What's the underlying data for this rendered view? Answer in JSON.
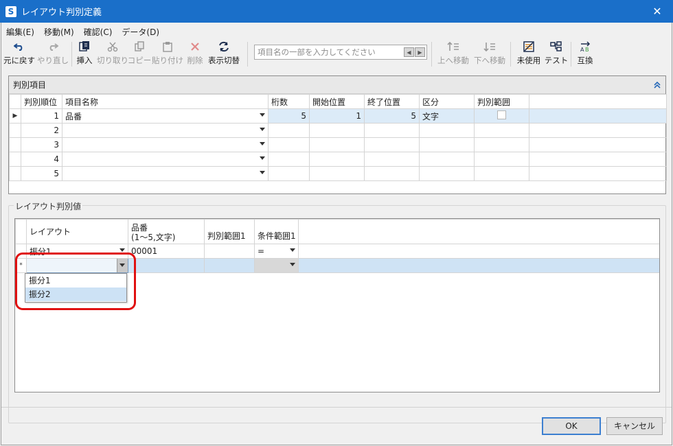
{
  "window": {
    "title": "レイアウト判別定義",
    "app_icon_letter": "S"
  },
  "menu": [
    "編集(E)",
    "移動(M)",
    "確認(C)",
    "データ(D)"
  ],
  "toolbar": {
    "undo": "元に戻す",
    "redo": "やり直し",
    "insert": "挿入",
    "cut": "切り取り",
    "copy": "コピー",
    "paste": "貼り付け",
    "delete": "削除",
    "toggle_display": "表示切替",
    "search_placeholder": "項目名の一部を入力してください",
    "move_up": "上へ移動",
    "move_down": "下へ移動",
    "unused": "未使用",
    "test": "テスト",
    "swap": "互換"
  },
  "panel1": {
    "title": "判別項目",
    "columns": [
      "判別順位",
      "項目名称",
      "桁数",
      "開始位置",
      "終了位置",
      "区分",
      "判別範囲"
    ],
    "rows": [
      {
        "order": "1",
        "name": "品番",
        "digits": "5",
        "start": "1",
        "end": "5",
        "kind": "文字"
      },
      {
        "order": "2",
        "name": "",
        "digits": "",
        "start": "",
        "end": "",
        "kind": ""
      },
      {
        "order": "3",
        "name": "",
        "digits": "",
        "start": "",
        "end": "",
        "kind": ""
      },
      {
        "order": "4",
        "name": "",
        "digits": "",
        "start": "",
        "end": "",
        "kind": ""
      },
      {
        "order": "5",
        "name": "",
        "digits": "",
        "start": "",
        "end": "",
        "kind": ""
      }
    ]
  },
  "panel2": {
    "title": "レイアウト判別値",
    "columns": {
      "layout": "レイアウト",
      "hinban_1": "品番",
      "hinban_2": "(1〜5,文字)",
      "range1": "判別範囲1",
      "cond1": "条件範囲1"
    },
    "rows": [
      {
        "layout": "振分1",
        "hinban": "00001",
        "range1": "",
        "cond1": "="
      }
    ],
    "new_row_marker": "*",
    "dropdown_options": [
      "振分1",
      "振分2"
    ]
  },
  "buttons": {
    "ok": "OK",
    "cancel": "キャンセル"
  },
  "colors": {
    "titlebar": "#1a6fc9",
    "highlight": "#e01010",
    "selection": "#dcebf8"
  }
}
